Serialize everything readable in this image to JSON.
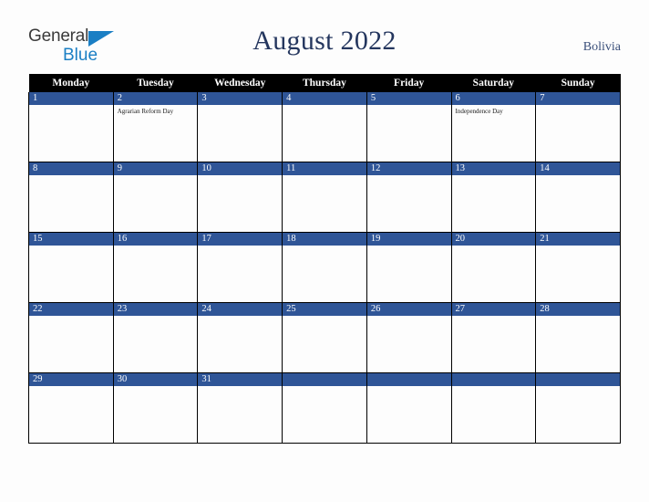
{
  "brand": {
    "name_part1": "General",
    "name_part2": "Blue",
    "triangle_icon": "triangle-icon",
    "color_primary": "#1b7fc4",
    "color_text": "#3b3b3b"
  },
  "header": {
    "title": "August 2022",
    "country": "Bolivia",
    "title_color": "#24365e",
    "country_color": "#3a4f7a"
  },
  "calendar": {
    "weekday_headers": [
      "Monday",
      "Tuesday",
      "Wednesday",
      "Thursday",
      "Friday",
      "Saturday",
      "Sunday"
    ],
    "header_bg": "#000000",
    "header_text": "#ffffff",
    "daynum_bg": "#2f5597",
    "daynum_text": "#ffffff",
    "cell_bg": "#fdfdfd",
    "grid_line": "#000000",
    "weeks": [
      [
        {
          "day": "1",
          "events": []
        },
        {
          "day": "2",
          "events": [
            "Agrarian Reform Day"
          ]
        },
        {
          "day": "3",
          "events": []
        },
        {
          "day": "4",
          "events": []
        },
        {
          "day": "5",
          "events": []
        },
        {
          "day": "6",
          "events": [
            "Independence Day"
          ]
        },
        {
          "day": "7",
          "events": []
        }
      ],
      [
        {
          "day": "8",
          "events": []
        },
        {
          "day": "9",
          "events": []
        },
        {
          "day": "10",
          "events": []
        },
        {
          "day": "11",
          "events": []
        },
        {
          "day": "12",
          "events": []
        },
        {
          "day": "13",
          "events": []
        },
        {
          "day": "14",
          "events": []
        }
      ],
      [
        {
          "day": "15",
          "events": []
        },
        {
          "day": "16",
          "events": []
        },
        {
          "day": "17",
          "events": []
        },
        {
          "day": "18",
          "events": []
        },
        {
          "day": "19",
          "events": []
        },
        {
          "day": "20",
          "events": []
        },
        {
          "day": "21",
          "events": []
        }
      ],
      [
        {
          "day": "22",
          "events": []
        },
        {
          "day": "23",
          "events": []
        },
        {
          "day": "24",
          "events": []
        },
        {
          "day": "25",
          "events": []
        },
        {
          "day": "26",
          "events": []
        },
        {
          "day": "27",
          "events": []
        },
        {
          "day": "28",
          "events": []
        }
      ],
      [
        {
          "day": "29",
          "events": []
        },
        {
          "day": "30",
          "events": []
        },
        {
          "day": "31",
          "events": []
        },
        {
          "day": "",
          "events": []
        },
        {
          "day": "",
          "events": []
        },
        {
          "day": "",
          "events": []
        },
        {
          "day": "",
          "events": []
        }
      ]
    ]
  }
}
